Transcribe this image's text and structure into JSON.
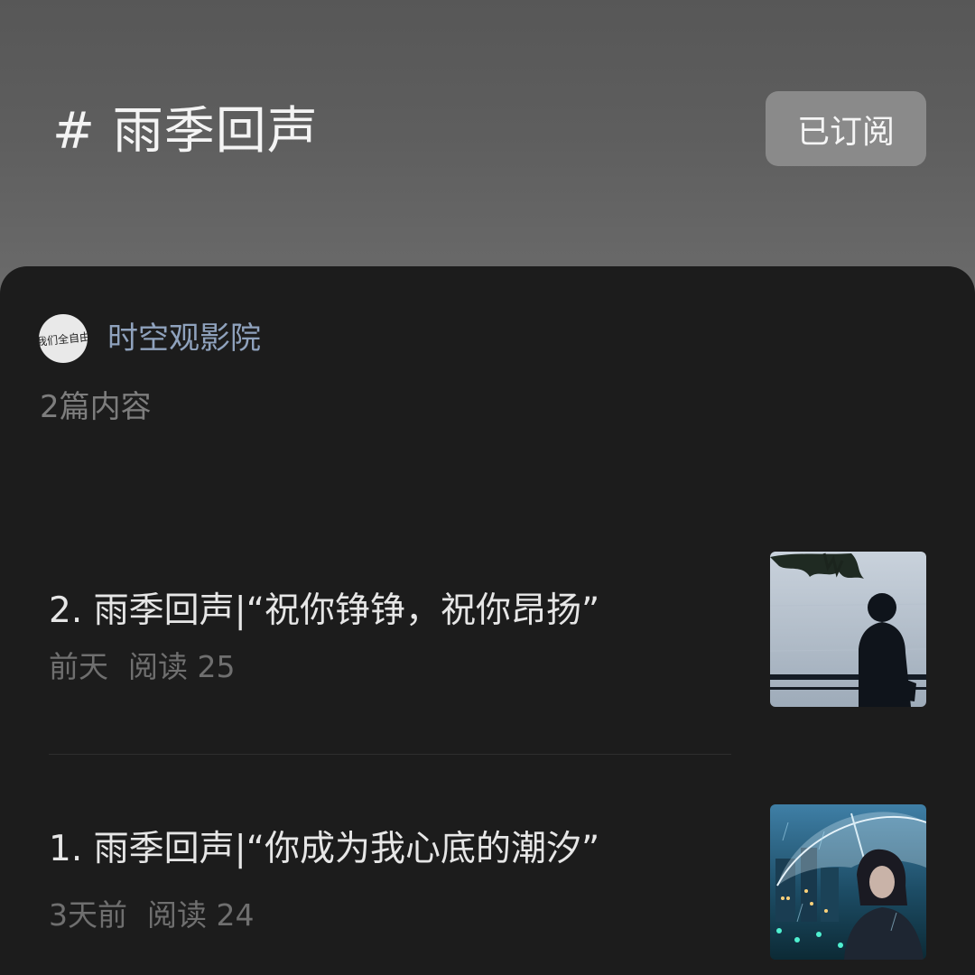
{
  "header": {
    "title": "# 雨季回声",
    "subscribe_label": "已订阅"
  },
  "author": {
    "name": "时空观影院",
    "avatar_text": "我们全自由"
  },
  "content_count": "2篇内容",
  "articles": [
    {
      "title": "2. 雨季回声|“祝你铮铮，祝你昂扬”",
      "time": "前天",
      "reads": "阅读 25",
      "thumbnail_icon": "girl-by-water-silhouette"
    },
    {
      "title": "1. 雨季回声|“你成为我心底的潮汐”",
      "time": "3天前",
      "reads": "阅读 24",
      "thumbnail_icon": "girl-with-umbrella-rain"
    }
  ]
}
